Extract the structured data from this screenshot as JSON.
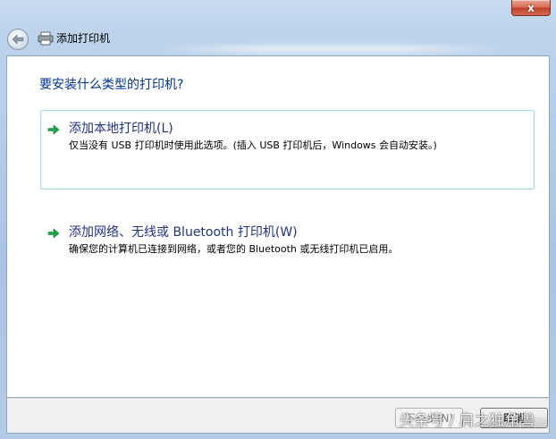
{
  "window": {
    "close_label": "x",
    "title": "添加打印机"
  },
  "page": {
    "heading": "要安装什么类型的打印机?"
  },
  "options": [
    {
      "title": "添加本地打印机(L)",
      "description": "仅当没有 USB 打印机时使用此选项。(插入 USB 打印机后，Windows 会自动安装。)",
      "selected": true
    },
    {
      "title": "添加网络、无线或 Bluetooth 打印机(W)",
      "description": "确保您的计算机已连接到网络，或者您的 Bluetooth 或无线打印机已启用。",
      "selected": false
    }
  ],
  "footer": {
    "next_label": "下一步(N)",
    "cancel_label": "取消"
  },
  "watermark": "头条号 / 肩之独角兽",
  "colors": {
    "heading": "#003399",
    "option_title": "#1e3287",
    "arrow": "#1ea54a",
    "selection_border": "#a8d8e6",
    "close_button": "#c7503a"
  },
  "icons": {
    "back": "back-arrow-icon",
    "title": "printer-icon",
    "option": "green-arrow-icon"
  }
}
